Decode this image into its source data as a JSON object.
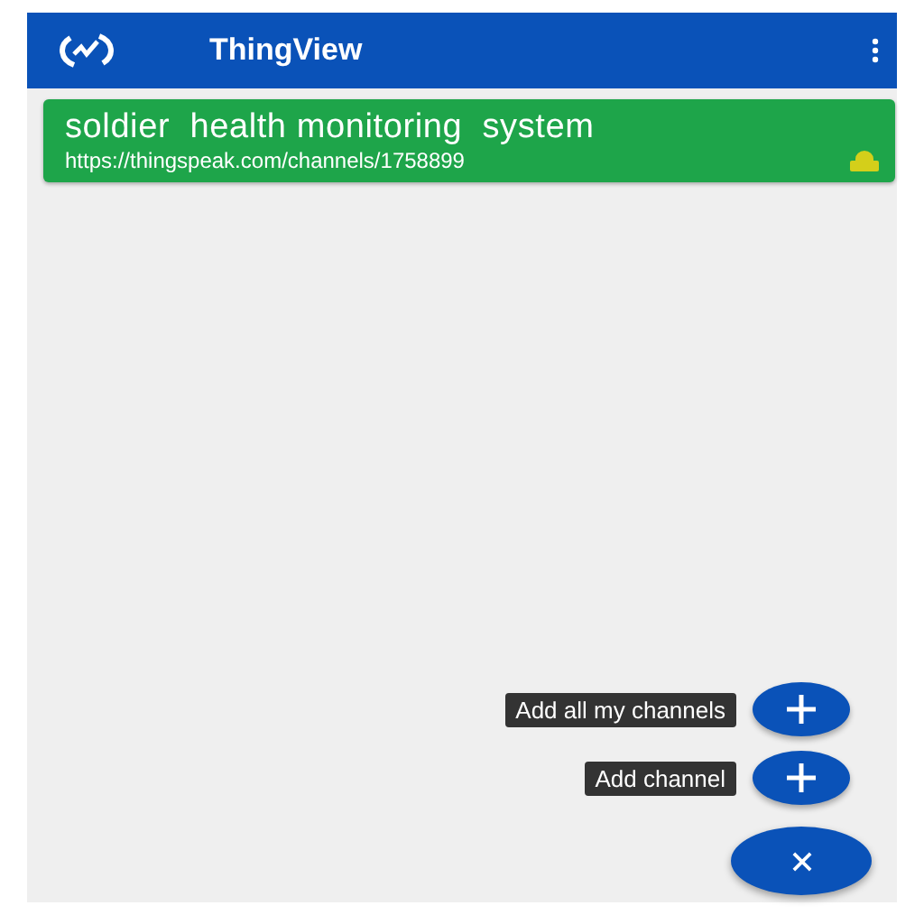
{
  "app_bar": {
    "title": "ThingView"
  },
  "channels": [
    {
      "name": "soldier  health monitoring  system",
      "url": "https://thingspeak.com/channels/1758899",
      "locked": true
    }
  ],
  "fab_menu": {
    "expanded": true,
    "actions": [
      {
        "label": "Add all my channels"
      },
      {
        "label": "Add channel"
      }
    ]
  }
}
